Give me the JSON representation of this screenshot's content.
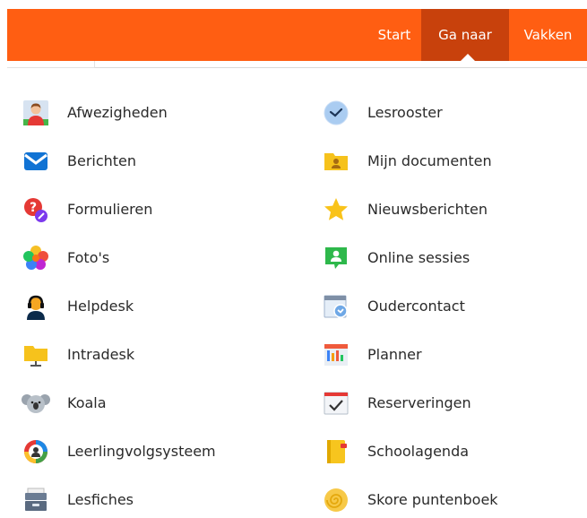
{
  "header": {
    "nav": [
      {
        "label": "Start"
      },
      {
        "label": "Ga naar"
      },
      {
        "label": "Vakken"
      }
    ]
  },
  "menu": {
    "left": [
      {
        "label": "Afwezigheden",
        "icon": "absence-person-icon"
      },
      {
        "label": "Berichten",
        "icon": "envelope-icon"
      },
      {
        "label": "Formulieren",
        "icon": "question-pencil-icon"
      },
      {
        "label": "Foto's",
        "icon": "photos-flower-icon"
      },
      {
        "label": "Helpdesk",
        "icon": "headset-person-icon"
      },
      {
        "label": "Intradesk",
        "icon": "folder-network-icon"
      },
      {
        "label": "Koala",
        "icon": "koala-icon"
      },
      {
        "label": "Leerlingvolgsysteem",
        "icon": "student-ring-icon"
      },
      {
        "label": "Lesfiches",
        "icon": "archive-box-icon"
      }
    ],
    "right": [
      {
        "label": "Lesrooster",
        "icon": "clock-icon"
      },
      {
        "label": "Mijn documenten",
        "icon": "user-folder-icon"
      },
      {
        "label": "Nieuwsberichten",
        "icon": "star-icon"
      },
      {
        "label": "Online sessies",
        "icon": "chat-person-icon"
      },
      {
        "label": "Oudercontact",
        "icon": "calendar-clock-icon"
      },
      {
        "label": "Planner",
        "icon": "planner-board-icon"
      },
      {
        "label": "Reserveringen",
        "icon": "calendar-check-icon"
      },
      {
        "label": "Schoolagenda",
        "icon": "notebook-icon"
      },
      {
        "label": "Skore puntenboek",
        "icon": "shell-icon"
      }
    ]
  },
  "colors": {
    "accent": "#ff5e12",
    "active_tab": "#c8410c"
  }
}
